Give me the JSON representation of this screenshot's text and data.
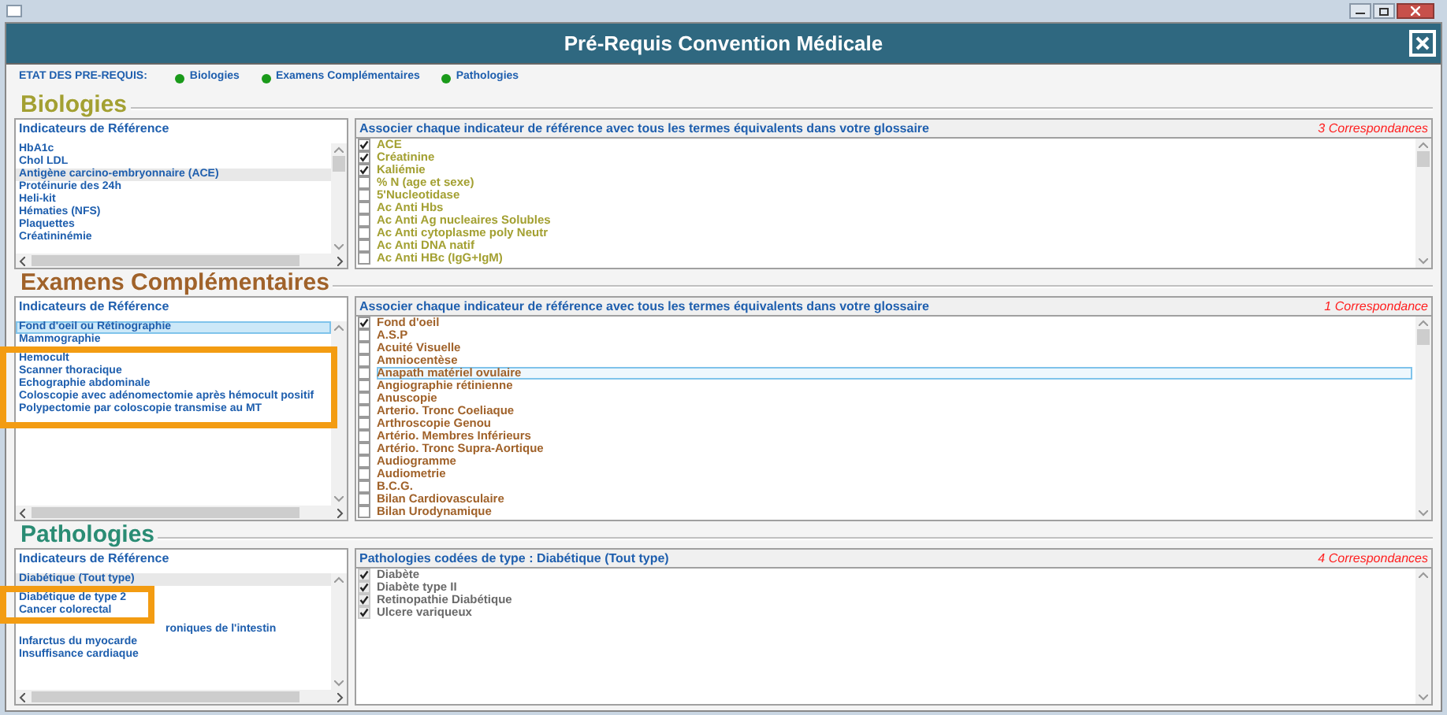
{
  "header": {
    "title": "Pré-Requis Convention Médicale"
  },
  "status": {
    "label": "ETAT DES PRE-REQUIS:",
    "items": [
      {
        "label": "Biologies",
        "on": true
      },
      {
        "label": "Examens Complémentaires",
        "on": true
      },
      {
        "label": "Pathologies",
        "on": true
      }
    ]
  },
  "sections": [
    {
      "kind": "biologies",
      "title": "Biologies",
      "left": {
        "header": "Indicateurs de Référence",
        "items": [
          {
            "label": "HbA1c",
            "selected": false
          },
          {
            "label": "Chol LDL",
            "selected": false
          },
          {
            "label": "Antigène carcino-embryonnaire (ACE)",
            "selected": true
          },
          {
            "label": "Protéinurie des 24h",
            "selected": false
          },
          {
            "label": "Heli-kit",
            "selected": false
          },
          {
            "label": "Hématies (NFS)",
            "selected": false
          },
          {
            "label": "Plaquettes",
            "selected": false
          },
          {
            "label": "Créatininémie",
            "selected": false
          }
        ]
      },
      "right": {
        "header": "Associer chaque indicateur de référence avec tous les termes équivalents dans votre glossaire",
        "count": "3 Correspondances",
        "terms": [
          {
            "label": "ACE",
            "checked": true,
            "selected": false
          },
          {
            "label": "Créatinine",
            "checked": true,
            "selected": false
          },
          {
            "label": "Kaliémie",
            "checked": true,
            "selected": false
          },
          {
            "label": "% N (age et sexe)",
            "checked": false,
            "selected": false
          },
          {
            "label": "5'Nucleotidase",
            "checked": false,
            "selected": false
          },
          {
            "label": "Ac Anti  Hbs",
            "checked": false,
            "selected": false
          },
          {
            "label": "Ac Anti Ag nucleaires Solubles",
            "checked": false,
            "selected": false
          },
          {
            "label": "Ac Anti cytoplasme poly Neutr",
            "checked": false,
            "selected": false
          },
          {
            "label": "Ac Anti DNA natif",
            "checked": false,
            "selected": false
          },
          {
            "label": "Ac Anti HBc (IgG+IgM)",
            "checked": false,
            "selected": false
          }
        ]
      }
    },
    {
      "kind": "examens",
      "title": "Examens Complémentaires",
      "left": {
        "header": "Indicateurs de Référence",
        "items": [
          {
            "label": "Fond d'oeil ou Rétinographie",
            "selected": true
          },
          {
            "label": "Mammographie",
            "selected": false
          },
          {
            "label": "Hemocult",
            "selected": false
          },
          {
            "label": "Scanner thoracique",
            "selected": false
          },
          {
            "label": "Echographie abdominale",
            "selected": false
          },
          {
            "label": "Coloscopie avec adénomectomie après hémocult positif",
            "selected": false
          },
          {
            "label": "Polypectomie par coloscopie transmise au MT",
            "selected": false
          }
        ]
      },
      "right": {
        "header": "Associer chaque indicateur de référence avec tous les termes équivalents dans votre glossaire",
        "count": "1 Correspondance",
        "terms": [
          {
            "label": "Fond d'oeil",
            "checked": true,
            "selected": false
          },
          {
            "label": "A.S.P",
            "checked": false,
            "selected": false
          },
          {
            "label": "Acuité Visuelle",
            "checked": false,
            "selected": false
          },
          {
            "label": "Amniocentèse",
            "checked": false,
            "selected": false
          },
          {
            "label": "Anapath matériel ovulaire",
            "checked": false,
            "selected": true
          },
          {
            "label": "Angiographie rétinienne",
            "checked": false,
            "selected": false
          },
          {
            "label": "Anuscopie",
            "checked": false,
            "selected": false
          },
          {
            "label": "Arterio. Tronc Coeliaque",
            "checked": false,
            "selected": false
          },
          {
            "label": "Arthroscopie Genou",
            "checked": false,
            "selected": false
          },
          {
            "label": "Artério. Membres Inférieurs",
            "checked": false,
            "selected": false
          },
          {
            "label": "Artério. Tronc Supra-Aortique",
            "checked": false,
            "selected": false
          },
          {
            "label": "Audiogramme",
            "checked": false,
            "selected": false
          },
          {
            "label": "Audiometrie",
            "checked": false,
            "selected": false
          },
          {
            "label": "B.C.G.",
            "checked": false,
            "selected": false
          },
          {
            "label": "Bilan Cardiovasculaire",
            "checked": false,
            "selected": false
          },
          {
            "label": "Bilan Urodynamique",
            "checked": false,
            "selected": false
          }
        ]
      }
    },
    {
      "kind": "pathologies",
      "title": "Pathologies",
      "left": {
        "header": "Indicateurs de Référence",
        "items": [
          {
            "label": "Diabétique (Tout type)",
            "selected": true
          },
          {
            "label": "Diabétique de type 2",
            "selected": false
          },
          {
            "label": "Cancer colorectal",
            "selected": false
          },
          {
            "label": "roniques de l'intestin",
            "selected": false
          },
          {
            "label": "Infarctus du myocarde",
            "selected": false
          },
          {
            "label": "Insuffisance cardiaque",
            "selected": false
          }
        ]
      },
      "right": {
        "header": "Pathologies codées de type : Diabétique (Tout type)",
        "count": "4 Correspondances",
        "terms": [
          {
            "label": "Diabète",
            "checked": true,
            "selected": false
          },
          {
            "label": "Diabète type II",
            "checked": true,
            "selected": false
          },
          {
            "label": "Retinopathie Diabétique",
            "checked": true,
            "selected": false
          },
          {
            "label": "Ulcere variqueux",
            "checked": true,
            "selected": false
          }
        ]
      }
    }
  ]
}
